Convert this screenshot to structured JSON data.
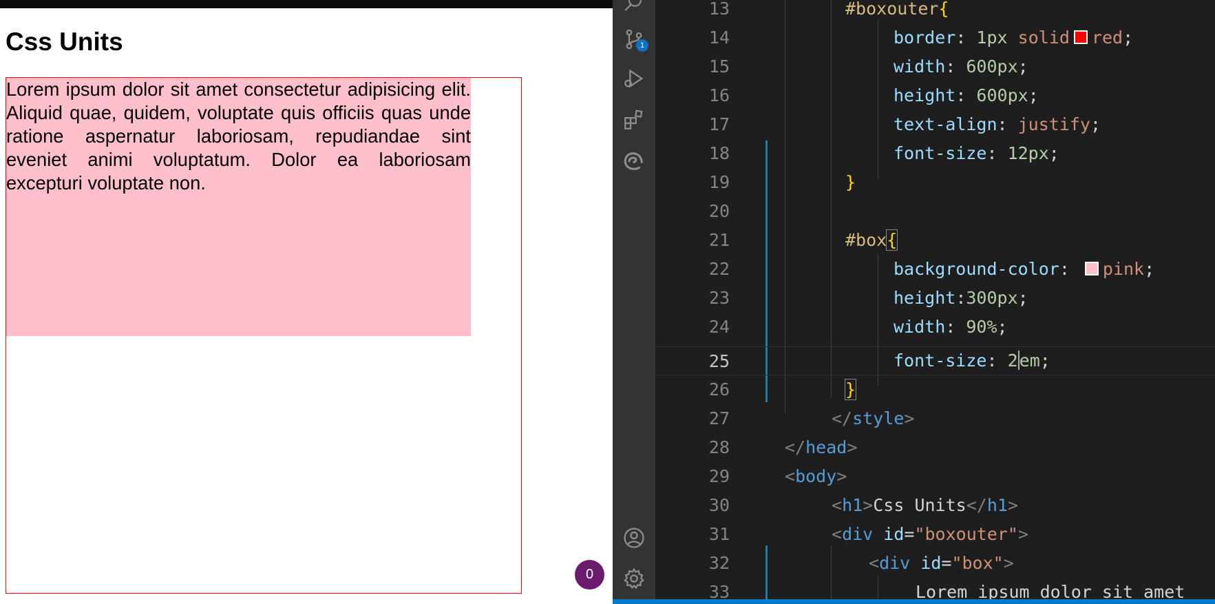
{
  "preview": {
    "heading": "Css Units",
    "box_text": "Lorem ipsum dolor sit amet consectetur adipisicing elit. Aliquid quae, quidem, voluptate quis officiis quas unde ratione aspernatur laboriosam, repudiandae sint eveniet animi voluptatum. Dolor ea laboriosam excepturi voluptate non.",
    "badge_count": "0",
    "colors": {
      "box_border": "#ff0000",
      "box_background": "#ffc0cb"
    }
  },
  "activity_bar": {
    "icons": [
      "search-icon",
      "source-control-icon",
      "run-debug-icon",
      "extensions-icon",
      "edge-browser-icon",
      "account-icon",
      "settings-gear-icon"
    ],
    "scm_badge": "1"
  },
  "editor": {
    "current_line": "25",
    "lines": [
      {
        "n": "13",
        "t1": "#boxouter",
        "t2": "{"
      },
      {
        "n": "14",
        "p": "border",
        "c": ":",
        "v1": " 1px",
        "v2": " solid",
        "color": "#ff0000",
        "v3": "red",
        "e": ";"
      },
      {
        "n": "15",
        "p": "width",
        "c": ":",
        "v1": " 600px",
        "e": ";"
      },
      {
        "n": "16",
        "p": "height",
        "c": ":",
        "v1": " 600px",
        "e": ";"
      },
      {
        "n": "17",
        "p": "text-align",
        "c": ":",
        "v2": " justify",
        "e": ";"
      },
      {
        "n": "18",
        "p": "font-size",
        "c": ":",
        "v1": " 12px",
        "e": ";"
      },
      {
        "n": "19",
        "b": "}"
      },
      {
        "n": "20"
      },
      {
        "n": "21",
        "t1": "#box",
        "t2": "{"
      },
      {
        "n": "22",
        "p": "background-color",
        "c": ":",
        "color": "#ffc0cb",
        "v3": "pink",
        "e": ";"
      },
      {
        "n": "23",
        "p": "height",
        "c": ":",
        "v1": "300px",
        "e": ";"
      },
      {
        "n": "24",
        "p": "width",
        "c": ":",
        "v1": " 90%",
        "e": ";"
      },
      {
        "n": "25",
        "p": "font-size",
        "c": ":",
        "v1a": " 2",
        "v1b": "em",
        "e": ";"
      },
      {
        "n": "26",
        "b": "}"
      },
      {
        "n": "27",
        "tag_open": "</",
        "tag": "style",
        "tag_close": ">"
      },
      {
        "n": "28",
        "tag_open": "</",
        "tag": "head",
        "tag_close": ">"
      },
      {
        "n": "29",
        "tag_open": "<",
        "tag": "body",
        "tag_close": ">"
      },
      {
        "n": "30",
        "tag_open": "<",
        "tag": "h1",
        "tag_close": ">",
        "text": "Css Units",
        "tag2_open": "</",
        "tag2": "h1",
        "tag2_close": ">"
      },
      {
        "n": "31",
        "tag_open": "<",
        "tag": "div",
        "attr": " id",
        "eq": "=",
        "val": "\"boxouter\"",
        "tag_close": ">"
      },
      {
        "n": "32",
        "tag_open": "<",
        "tag": "div",
        "attr": " id",
        "eq": "=",
        "val": "\"box\"",
        "tag_close": ">"
      },
      {
        "n": "33",
        "text": "Lorem ipsum dolor sit amet"
      }
    ]
  }
}
